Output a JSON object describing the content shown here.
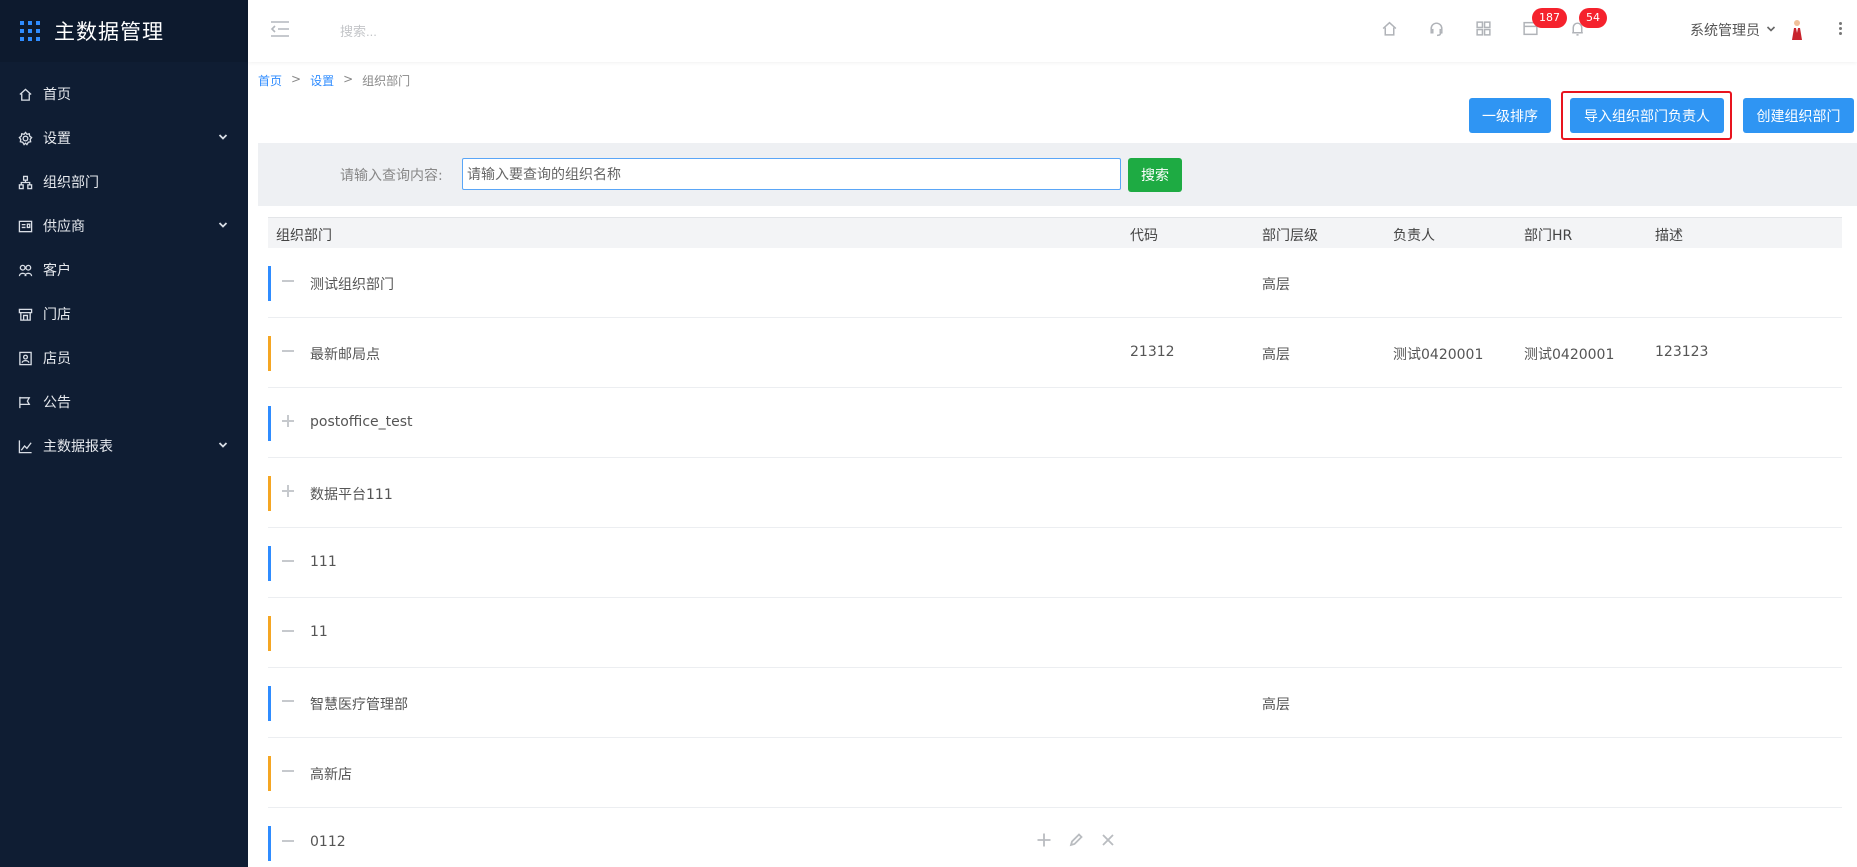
{
  "sidebar": {
    "title": "主数据管理",
    "items": [
      {
        "label": "首页",
        "icon": "home-icon",
        "expandable": false
      },
      {
        "label": "设置",
        "icon": "settings-icon",
        "expandable": true
      },
      {
        "label": "组织部门",
        "icon": "org-tree-icon",
        "expandable": false
      },
      {
        "label": "供应商",
        "icon": "supplier-card-icon",
        "expandable": true
      },
      {
        "label": "客户",
        "icon": "customer-icon",
        "expandable": false
      },
      {
        "label": "门店",
        "icon": "store-icon",
        "expandable": false
      },
      {
        "label": "店员",
        "icon": "staff-icon",
        "expandable": false
      },
      {
        "label": "公告",
        "icon": "announcement-icon",
        "expandable": false
      },
      {
        "label": "主数据报表",
        "icon": "report-chart-icon",
        "expandable": true
      }
    ]
  },
  "header": {
    "search_placeholder": "搜索...",
    "icons": [
      "home-icon",
      "headset-icon",
      "apps-grid-icon",
      "message-icon",
      "bell-icon"
    ],
    "message_count": "187",
    "notification_count": "54",
    "user_name": "系统管理员"
  },
  "breadcrumb": {
    "home": "首页",
    "settings": "设置",
    "current": "组织部门",
    "separator": ">"
  },
  "toolbar": {
    "sort_label": "一级排序",
    "import_label": "导入组织部门负责人",
    "create_label": "创建组织部门"
  },
  "filter": {
    "label": "请输入查询内容:",
    "placeholder": "请输入要查询的组织名称",
    "search_label": "搜索"
  },
  "table": {
    "columns": [
      "组织部门",
      "代码",
      "部门层级",
      "负责人",
      "部门HR",
      "描述"
    ],
    "rows": [
      {
        "name": "测试组织部门",
        "code": "",
        "level": "高层",
        "owner": "",
        "hr": "",
        "desc": "",
        "state": "expanded",
        "accent": "#2f8cff"
      },
      {
        "name": "最新邮局点",
        "code": "21312",
        "level": "高层",
        "owner": "测试0420001",
        "hr": "测试0420001",
        "desc": "123123",
        "state": "expanded",
        "accent": "#f5a623"
      },
      {
        "name": "postoffice_test",
        "code": "",
        "level": "",
        "owner": "",
        "hr": "",
        "desc": "",
        "state": "collapsed",
        "accent": "#2f8cff"
      },
      {
        "name": "数据平台111",
        "code": "",
        "level": "",
        "owner": "",
        "hr": "",
        "desc": "",
        "state": "collapsed",
        "accent": "#f5a623"
      },
      {
        "name": "111",
        "code": "",
        "level": "",
        "owner": "",
        "hr": "",
        "desc": "",
        "state": "expanded",
        "accent": "#2f8cff"
      },
      {
        "name": "11",
        "code": "",
        "level": "",
        "owner": "",
        "hr": "",
        "desc": "",
        "state": "expanded",
        "accent": "#f5a623"
      },
      {
        "name": "智慧医疗管理部",
        "code": "",
        "level": "高层",
        "owner": "",
        "hr": "",
        "desc": "",
        "state": "expanded",
        "accent": "#2f8cff"
      },
      {
        "name": "高新店",
        "code": "",
        "level": "",
        "owner": "",
        "hr": "",
        "desc": "",
        "state": "expanded",
        "accent": "#f5a623"
      },
      {
        "name": "0112",
        "code": "",
        "level": "",
        "owner": "",
        "hr": "",
        "desc": "",
        "state": "expanded",
        "accent": "#2f8cff",
        "actions": [
          "add-icon",
          "edit-icon",
          "delete-icon"
        ]
      }
    ]
  },
  "colors": {
    "sidebar_bg": "#0f1d33",
    "primary": "#2f95f3",
    "success": "#1eab43",
    "badge": "#f5222d",
    "highlight": "#e8141e"
  }
}
